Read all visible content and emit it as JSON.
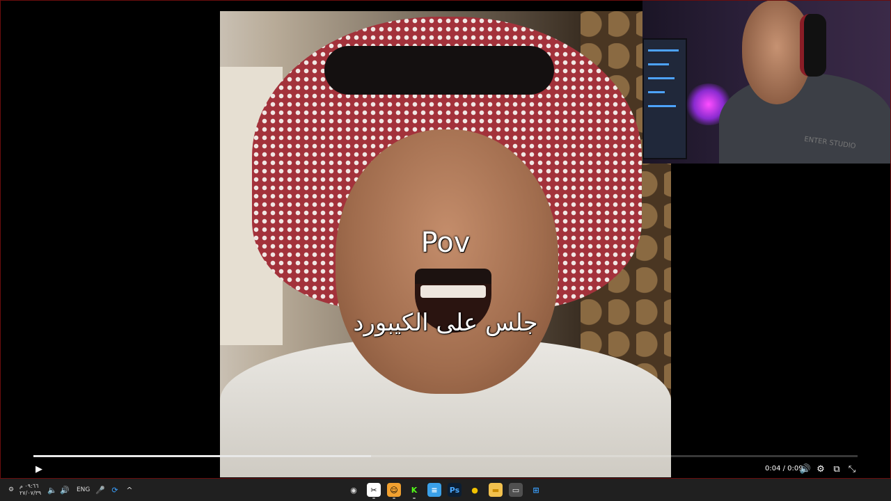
{
  "video": {
    "caption_main": "Pov",
    "caption_sub": "جلس على الكيبورد"
  },
  "webcam": {
    "hoodie_text": "ENTER STUDIO"
  },
  "player": {
    "progress_fraction": 0.41,
    "time": "0:04 / 0:09",
    "play_icon": "▶",
    "volume_icon": "🔊",
    "settings_icon": "⚙",
    "pip_icon": "⧉",
    "fullscreen_icon": "⤡"
  },
  "taskbar": {
    "clock_time": "٠٩:٦٦ م",
    "clock_date": "٢٧/٠٧/٣٩",
    "language": "ENG",
    "tray_icons": [
      "notification-icon",
      "volume-icon",
      "speaker-icon",
      "microphone-icon",
      "sync-icon",
      "chevron-up-icon"
    ],
    "apps": [
      {
        "name": "obs-icon",
        "glyph": "◉",
        "bg": "#202020",
        "fg": "#ddd"
      },
      {
        "name": "capcut-icon",
        "glyph": "✂",
        "bg": "#ffffff",
        "fg": "#000"
      },
      {
        "name": "discord-icon",
        "glyph": "☺",
        "bg": "#f0a030",
        "fg": "#000"
      },
      {
        "name": "kick-icon",
        "glyph": "K",
        "bg": "#202020",
        "fg": "#53fc18"
      },
      {
        "name": "notepad-icon",
        "glyph": "≡",
        "bg": "#3aa0e8",
        "fg": "#fff"
      },
      {
        "name": "photoshop-icon",
        "glyph": "Ps",
        "bg": "#0b1e33",
        "fg": "#4aa8ff"
      },
      {
        "name": "chrome-icon",
        "glyph": "●",
        "bg": "#202020",
        "fg": "#f2c200"
      },
      {
        "name": "file-explorer-icon",
        "glyph": "▬",
        "bg": "#f2c14e",
        "fg": "#c98a00"
      },
      {
        "name": "window-icon",
        "glyph": "▭",
        "bg": "#505050",
        "fg": "#eee"
      },
      {
        "name": "windows-start-icon",
        "glyph": "⊞",
        "bg": "#202020",
        "fg": "#3aa0ff"
      }
    ]
  }
}
